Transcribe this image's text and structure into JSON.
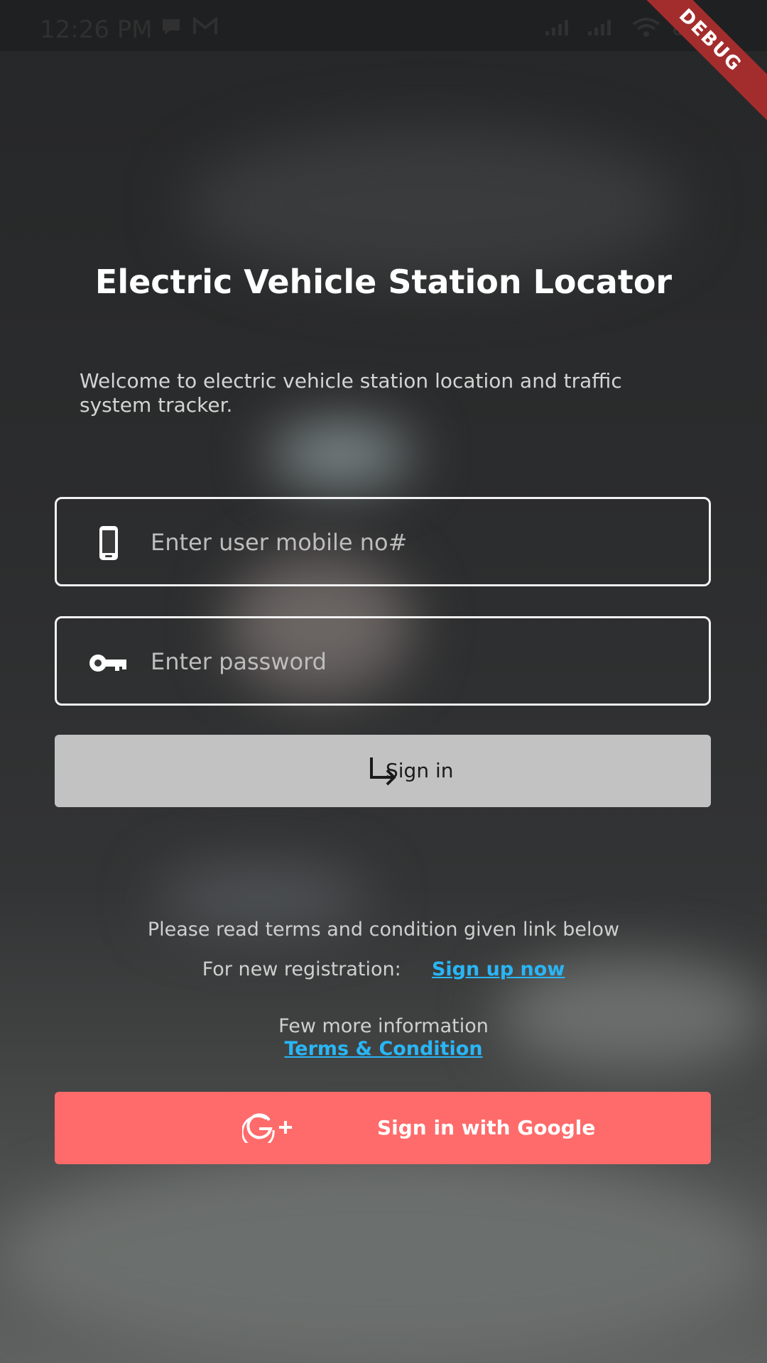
{
  "status_bar": {
    "time": "12:26 PM",
    "icons": [
      "message-icon",
      "gmail-icon",
      "signal-icon",
      "signal-icon",
      "wifi-icon",
      "battery-icon"
    ]
  },
  "debug_banner": "DEBUG",
  "header": {
    "title": "Electric Vehicle Station Locator",
    "welcome": "Welcome to electric vehicle station location and traffic system tracker."
  },
  "form": {
    "mobile_placeholder": "Enter user mobile no#",
    "password_placeholder": "Enter password",
    "signin_label": "Sign in"
  },
  "info": {
    "terms_note": "Please read terms and condition given link below",
    "registration_label": "For new registration:",
    "signup_link": "Sign up now",
    "more_info": "Few more information",
    "terms_link": "Terms & Condition"
  },
  "google_button": {
    "label": "Sign in with Google"
  },
  "colors": {
    "accent_link": "#29b6f6",
    "google_button": "#ff6b6b",
    "signin_button": "#c2c2c2"
  }
}
